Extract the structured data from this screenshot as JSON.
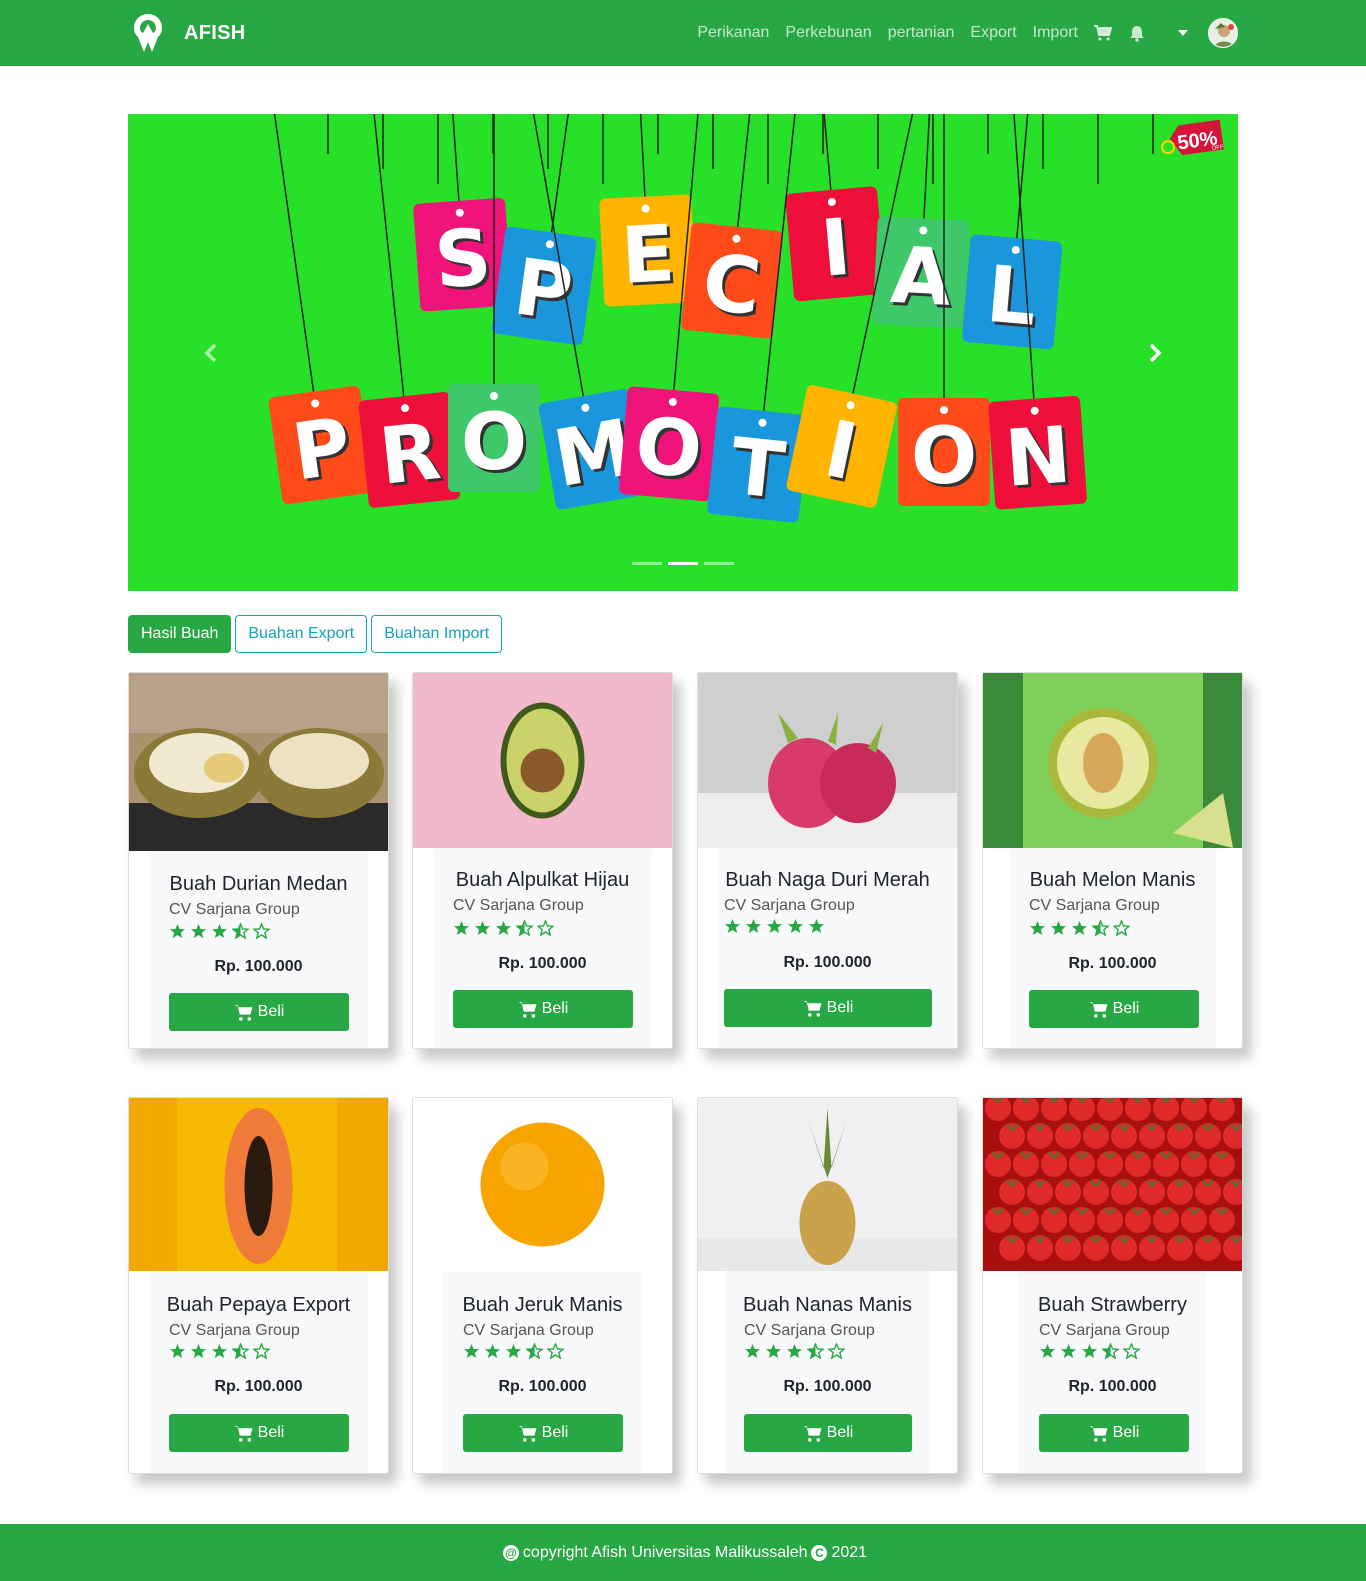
{
  "brand": {
    "name": "AFISH"
  },
  "nav": {
    "links": [
      "Perikanan",
      "Perkebunan",
      "pertanian",
      "Export",
      "Import"
    ]
  },
  "banner": {
    "top_word": "SPECIAL",
    "bottom_word": "PROMOTION",
    "badge": "50%",
    "badge_sub": "OFF",
    "slide_count": 3,
    "active_slide": 2
  },
  "filters": [
    "Hasil Buah",
    "Buahan Export",
    "Buahan Import"
  ],
  "products": [
    {
      "title": "Buah Durian Medan",
      "seller": "CV Sarjana Group",
      "rating": 3.5,
      "price": "Rp. 100.000",
      "buy": "Beli",
      "image": "durian"
    },
    {
      "title": "Buah Alpulkat Hijau",
      "seller": "CV Sarjana Group",
      "rating": 3.5,
      "price": "Rp. 100.000",
      "buy": "Beli",
      "image": "avocado"
    },
    {
      "title": "Buah Naga Duri Merah",
      "seller": "CV Sarjana Group",
      "rating": 5,
      "price": "Rp. 100.000",
      "buy": "Beli",
      "image": "dragonfruit"
    },
    {
      "title": "Buah Melon Manis",
      "seller": "CV Sarjana Group",
      "rating": 3.5,
      "price": "Rp. 100.000",
      "buy": "Beli",
      "image": "melon"
    },
    {
      "title": "Buah Pepaya Export",
      "seller": "CV Sarjana Group",
      "rating": 3.5,
      "price": "Rp. 100.000",
      "buy": "Beli",
      "image": "papaya"
    },
    {
      "title": "Buah Jeruk Manis",
      "seller": "CV Sarjana Group",
      "rating": 3.5,
      "price": "Rp. 100.000",
      "buy": "Beli",
      "image": "orange"
    },
    {
      "title": "Buah Nanas Manis",
      "seller": "CV Sarjana Group",
      "rating": 3.5,
      "price": "Rp. 100.000",
      "buy": "Beli",
      "image": "pineapple"
    },
    {
      "title": "Buah Strawberry",
      "seller": "CV Sarjana Group",
      "rating": 3.5,
      "price": "Rp. 100.000",
      "buy": "Beli",
      "image": "strawberry"
    }
  ],
  "footer": {
    "text": "copyright Afish Universitas Malikussaleh",
    "year": "2021"
  },
  "colors": {
    "primary": "#28a745",
    "info": "#17a2b8",
    "banner": "#28e028",
    "star": "#28a745"
  },
  "icons": {
    "cart": "cart-icon",
    "bell": "bell-icon",
    "caret": "caret-down-icon",
    "prev": "chevron-left-icon",
    "next": "chevron-right-icon",
    "star": "star-icon"
  }
}
